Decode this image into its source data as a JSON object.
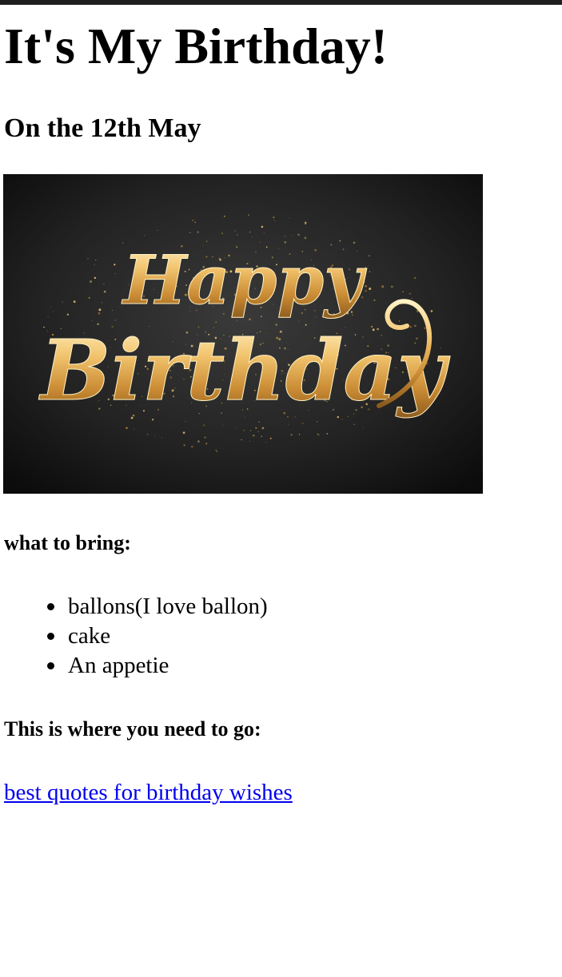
{
  "page": {
    "title": "It's My Birthday!",
    "subtitle": "On the 12th May",
    "top_bar_color": "#1f1f1f"
  },
  "banner": {
    "line1": "Happy",
    "line2": "Birthday",
    "background": "#262626",
    "gold": "#e8b45a"
  },
  "bring": {
    "heading": "what to bring:",
    "items": [
      "ballons(I love ballon)",
      "cake",
      "An appetie"
    ]
  },
  "go": {
    "heading": "This is where you need to go:",
    "link_text": "best quotes for birthday wishes",
    "link_color": "#0000ee"
  }
}
